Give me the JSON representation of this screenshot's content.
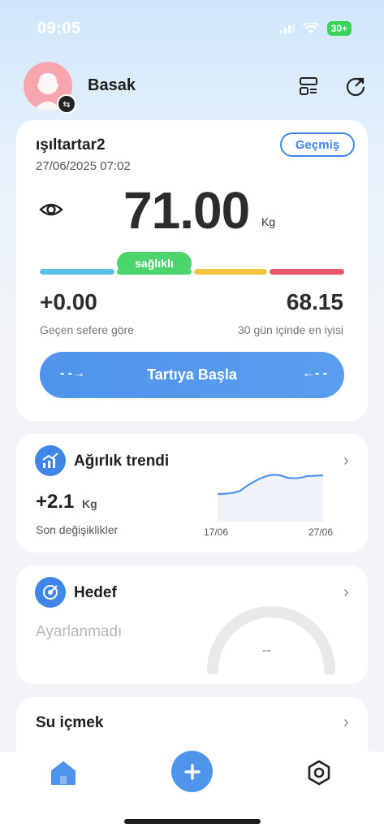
{
  "status": {
    "time": "09:05",
    "battery": "30+"
  },
  "header": {
    "username": "Basak"
  },
  "scale_card": {
    "device_name": "ışıltartar2",
    "datetime": "27/06/2025 07:02",
    "history_label": "Geçmiş",
    "weight": "71.00",
    "unit": "Kg",
    "status_label": "sağlıklı",
    "change_value": "+0.00",
    "change_label": "Geçen sefere göre",
    "best_value": "68.15",
    "best_label": "30 gün içinde en iyisi",
    "start_label": "Tartıya Başla",
    "bar_colors": [
      "#5bc0e6",
      "#4cd46d",
      "#f4c542",
      "#e8566a"
    ]
  },
  "trend_card": {
    "title": "Ağırlık trendi",
    "change": "+2.1",
    "unit": "Kg",
    "subtitle": "Son değişiklikler",
    "date_start": "17/06",
    "date_end": "27/06"
  },
  "goal_card": {
    "title": "Hedef",
    "status": "Ayarlanmadı",
    "gauge_value": "--"
  },
  "water_card": {
    "title": "Su içmek"
  },
  "nav": {
    "items": [
      {
        "icon": "home-icon"
      },
      {
        "icon": "plus-icon"
      },
      {
        "icon": "settings-icon"
      }
    ]
  }
}
